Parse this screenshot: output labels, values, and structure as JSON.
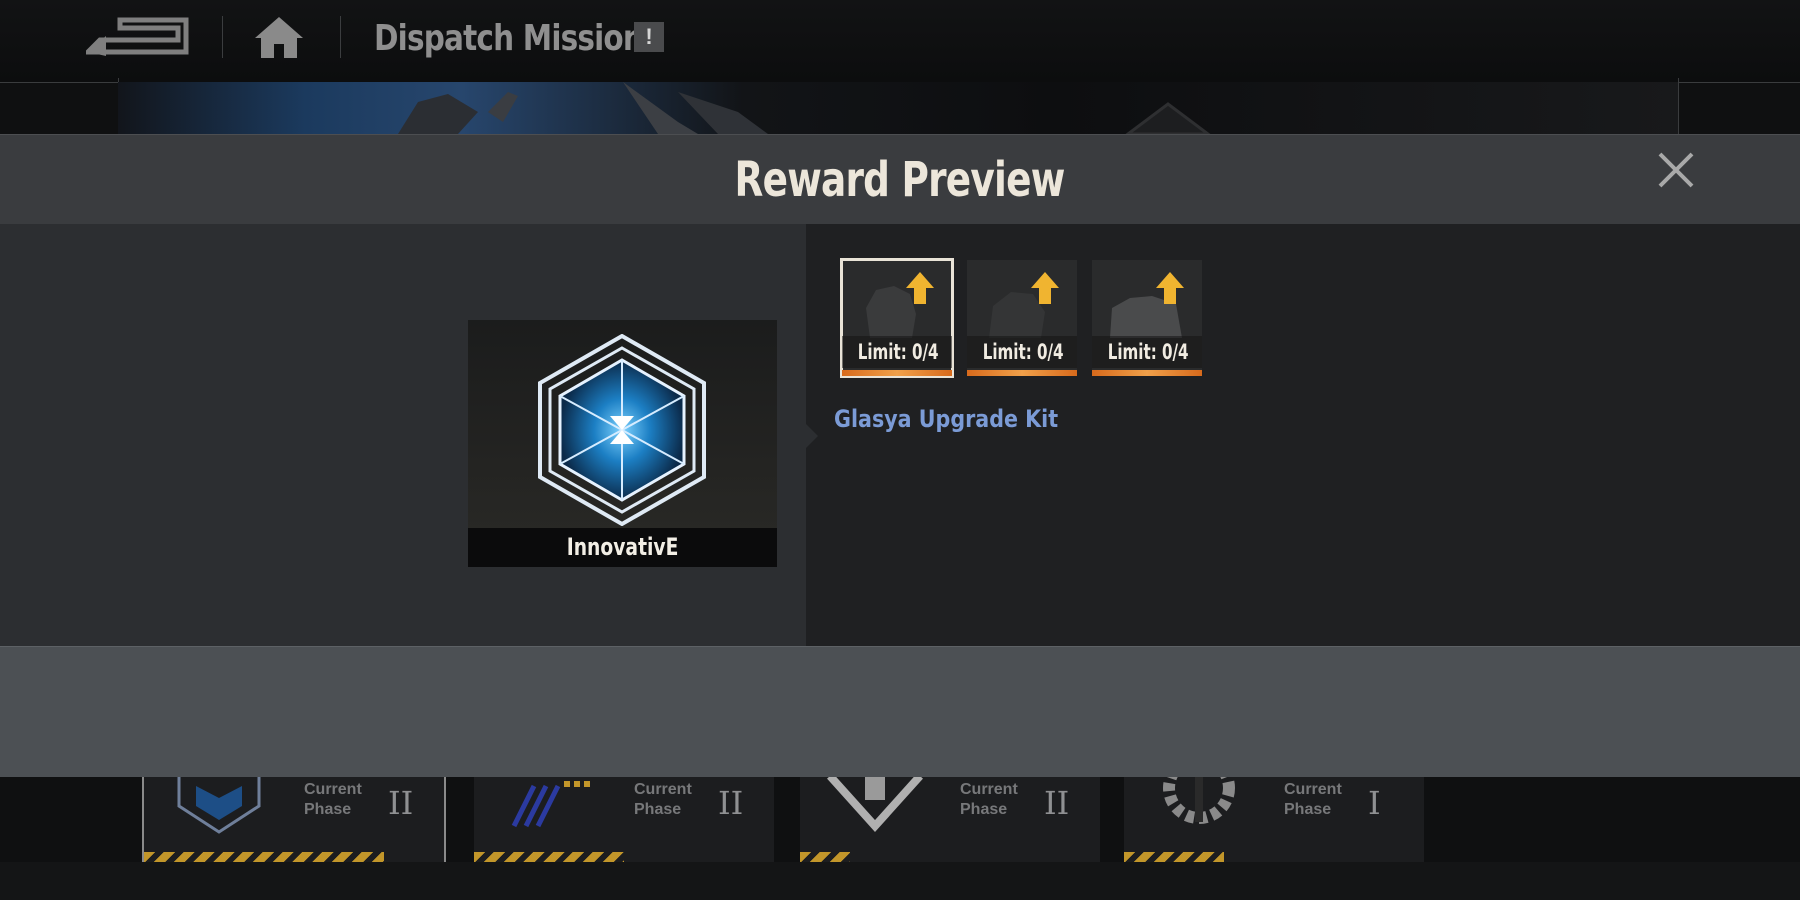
{
  "header": {
    "title": "Dispatch Missions",
    "info_badge": "!"
  },
  "modal": {
    "title": "Reward Preview",
    "badge": {
      "label": "InnovativE",
      "icon": "innovative-hexagon-emblem-icon"
    },
    "rewards": [
      {
        "limit": "Limit: 0/4",
        "selected": true,
        "icon": "upgrade-kit-icon"
      },
      {
        "limit": "Limit: 0/4",
        "selected": false,
        "icon": "upgrade-kit-icon"
      },
      {
        "limit": "Limit: 0/4",
        "selected": false,
        "icon": "upgrade-kit-icon"
      }
    ],
    "selected_item_name": "Glasya Upgrade Kit"
  },
  "missions": [
    {
      "phase_label": "Current Phase",
      "phase": "II",
      "progress": 0.75,
      "selected": true
    },
    {
      "phase_label": "Current Phase",
      "phase": "II",
      "progress": 0.5,
      "selected": false
    },
    {
      "phase_label": "Current Phase",
      "phase": "II",
      "progress": 0.17,
      "selected": false
    },
    {
      "phase_label": "Current Phase",
      "phase": "I",
      "progress": 0.34,
      "selected": false
    }
  ],
  "colors": {
    "accent_text": "#7b9bd6",
    "rarity_orange": "#e88a30",
    "stripe_yellow": "#c2962a"
  }
}
